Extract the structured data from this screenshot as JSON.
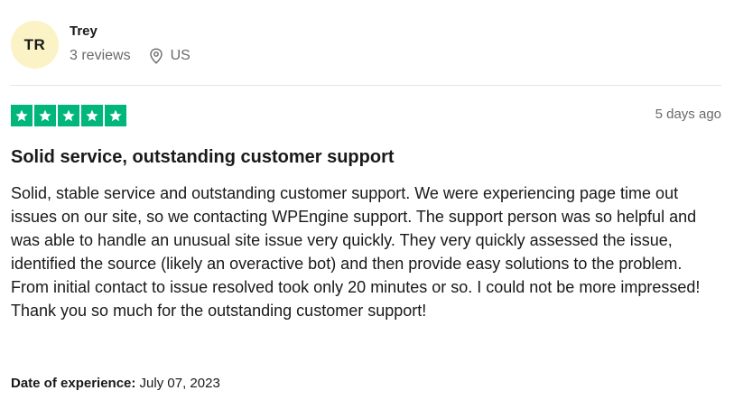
{
  "reviewer": {
    "initials": "TR",
    "name": "Trey",
    "reviews_count": "3 reviews",
    "country": "US",
    "avatar_color": "#fbf3c6"
  },
  "review": {
    "rating": 5,
    "star_color": "#00b67a",
    "date": "5 days ago",
    "title": "Solid service, outstanding customer support",
    "body": "Solid, stable service and outstanding customer support. We were experiencing page time out issues on our site, so we contacting WPEngine support. The support person was so helpful and was able to handle an unusual site issue very quickly. They very quickly assessed the issue, identified the source (likely an overactive bot) and then provide easy solutions to the problem. From initial contact to issue resolved took only 20 minutes or so. I could not be more impressed! Thank you so much for the outstanding customer support!",
    "experience_label": "Date of experience:",
    "experience_date": " July 07, 2023"
  },
  "icons": {
    "location": "location-pin-icon",
    "star": "star-icon"
  }
}
